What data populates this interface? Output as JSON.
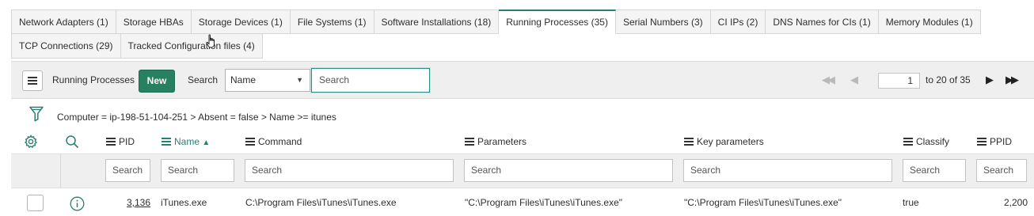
{
  "tabs": {
    "row1": [
      {
        "label": "Network Adapters (1)",
        "active": false
      },
      {
        "label": "Storage HBAs",
        "active": false
      },
      {
        "label": "Storage Devices (1)",
        "active": false
      },
      {
        "label": "File Systems (1)",
        "active": false
      },
      {
        "label": "Software Installations (18)",
        "active": false
      },
      {
        "label": "Running Processes (35)",
        "active": true
      },
      {
        "label": "Serial Numbers (3)",
        "active": false
      },
      {
        "label": "CI IPs (2)",
        "active": false
      },
      {
        "label": "DNS Names for CIs (1)",
        "active": false
      },
      {
        "label": "Memory Modules (1)",
        "active": false
      }
    ],
    "row2": [
      {
        "label": "TCP Connections (29)",
        "active": false
      },
      {
        "label": "Tracked Configuration files (4)",
        "active": false
      }
    ]
  },
  "toolbar": {
    "title": "Running Processes",
    "new_label": "New",
    "search_label": "Search",
    "field_select": "Name",
    "search_placeholder": "Search"
  },
  "pagination": {
    "page_value": "1",
    "range_text": "to 20 of 35"
  },
  "breadcrumb": "Computer = ip-198-51-104-251 > Absent = false > Name >= itunes",
  "columns": [
    {
      "label": "PID",
      "sorted": false
    },
    {
      "label": "Name",
      "sorted": true,
      "sort_glyph": "▲"
    },
    {
      "label": "Command",
      "sorted": false
    },
    {
      "label": "Parameters",
      "sorted": false
    },
    {
      "label": "Key parameters",
      "sorted": false
    },
    {
      "label": "Classify",
      "sorted": false
    },
    {
      "label": "PPID",
      "sorted": false
    }
  ],
  "column_search_placeholders": [
    "Search",
    "Search",
    "Search",
    "Search",
    "Search",
    "Search",
    "Search"
  ],
  "rows": [
    {
      "pid": "3,136",
      "name": "iTunes.exe",
      "command": "C:\\Program Files\\iTunes\\iTunes.exe",
      "parameters": "\"C:\\Program Files\\iTunes\\iTunes.exe\"",
      "key_parameters": "\"C:\\Program Files\\iTunes\\iTunes.exe\"",
      "classify": "true",
      "ppid": "2,200"
    }
  ],
  "icons": {
    "filter": "funnel-icon",
    "settings": "gear-icon",
    "search": "magnifier-icon",
    "info": "info-circle-icon",
    "menu": "hamburger-icon"
  },
  "colors": {
    "accent": "#2a7f74",
    "new_button": "#278060",
    "toolbar_bg": "#efefef"
  }
}
